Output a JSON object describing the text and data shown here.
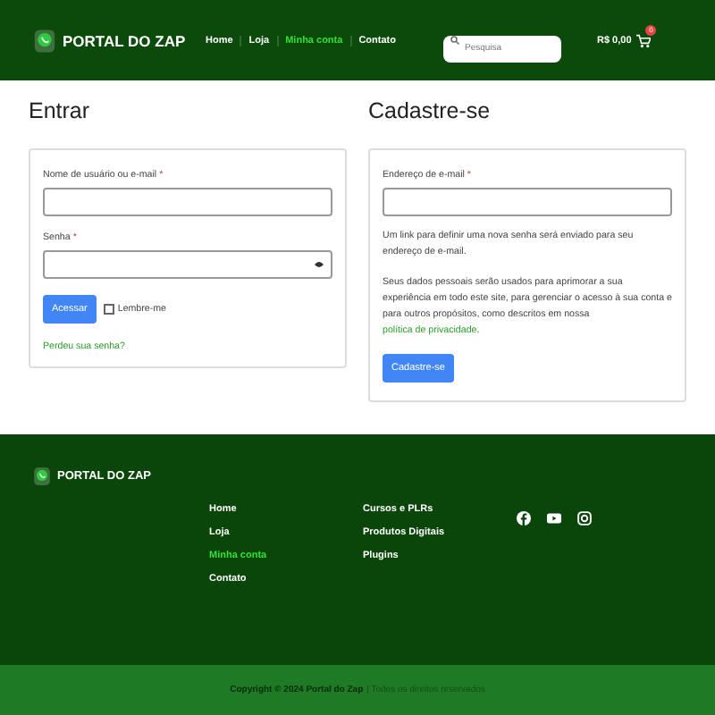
{
  "header": {
    "logo": "PORTAL DO ZAP",
    "nav": [
      {
        "label": "Home",
        "selected": false
      },
      {
        "label": "Loja",
        "selected": false
      },
      {
        "label": "Minha conta",
        "selected": true
      },
      {
        "label": "Contato",
        "selected": false
      }
    ],
    "search": {
      "placeholder": "Pesquisa"
    },
    "cart": {
      "total": "R$ 0,00",
      "count": "0"
    }
  },
  "login": {
    "title": "Entrar",
    "fields": [
      {
        "label": "Nome de usuário ou e-mail",
        "required_mark": "*",
        "kind": "text"
      },
      {
        "label": "Senha",
        "required_mark": "*",
        "kind": "password"
      }
    ],
    "submit": "Acessar",
    "remember": {
      "label": "Lembre-me",
      "checked": false
    },
    "lost_password": "Perdeu sua senha?"
  },
  "register": {
    "title": "Cadastre-se",
    "field": {
      "label": "Endereço de e-mail",
      "required_mark": "*"
    },
    "note": "Um link para definir uma nova senha será enviado para seu endereço de e-mail.",
    "privacy_text": "Seus dados pessoais serão usados para aprimorar a sua experiência em todo este site, para gerenciar o acesso à sua conta e para outros propósitos, como descritos em nossa ",
    "privacy_link": "política de privacidade",
    "privacy_end": ".",
    "submit": "Cadastre-se"
  },
  "footer": {
    "logo": "PORTAL DO ZAP",
    "links": [
      {
        "label": "Home",
        "selected": false
      },
      {
        "label": "Loja",
        "selected": false
      },
      {
        "label": "Minha conta",
        "selected": true
      },
      {
        "label": "Contato",
        "selected": false
      }
    ],
    "categories": [
      {
        "label": "Cursos e PLRs"
      },
      {
        "label": "Produtos Digitais"
      },
      {
        "label": "Plugins"
      }
    ],
    "social": [
      {
        "kind": "facebook"
      },
      {
        "kind": "youtube"
      },
      {
        "kind": "instagram"
      }
    ],
    "copyright": "Copyright © 2024 Portal do Zap",
    "rights": "| Todos os direitos reservados"
  }
}
